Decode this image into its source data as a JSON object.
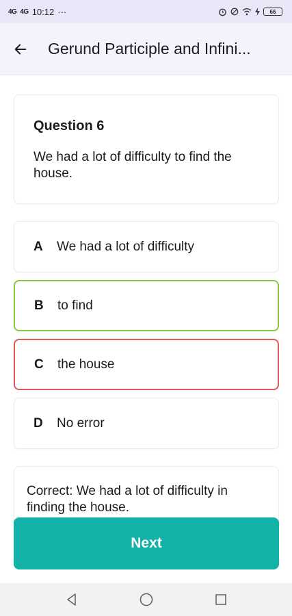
{
  "status_bar": {
    "signal1": "4G",
    "signal2": "4G",
    "time": "10:12",
    "dots": "···",
    "battery": "66"
  },
  "app_bar": {
    "title": "Gerund Participle and Infini..."
  },
  "question": {
    "title": "Question 6",
    "text": "We had a lot of difficulty to find the house."
  },
  "options": [
    {
      "letter": "A",
      "text": "We had a lot of difficulty",
      "state": "neutral"
    },
    {
      "letter": "B",
      "text": "to find",
      "state": "correct"
    },
    {
      "letter": "C",
      "text": "the house",
      "state": "wrong"
    },
    {
      "letter": "D",
      "text": "No error",
      "state": "neutral"
    }
  ],
  "explanation": {
    "text": "Correct: We had a lot of difficulty in finding the house."
  },
  "next_button": {
    "label": "Next"
  },
  "colors": {
    "accent": "#12b2a8",
    "correct_border": "#8cc63f",
    "wrong_border": "#e05a5a",
    "app_bar_bg": "#f4f2fb",
    "status_bar_bg": "#e8e6f7"
  }
}
